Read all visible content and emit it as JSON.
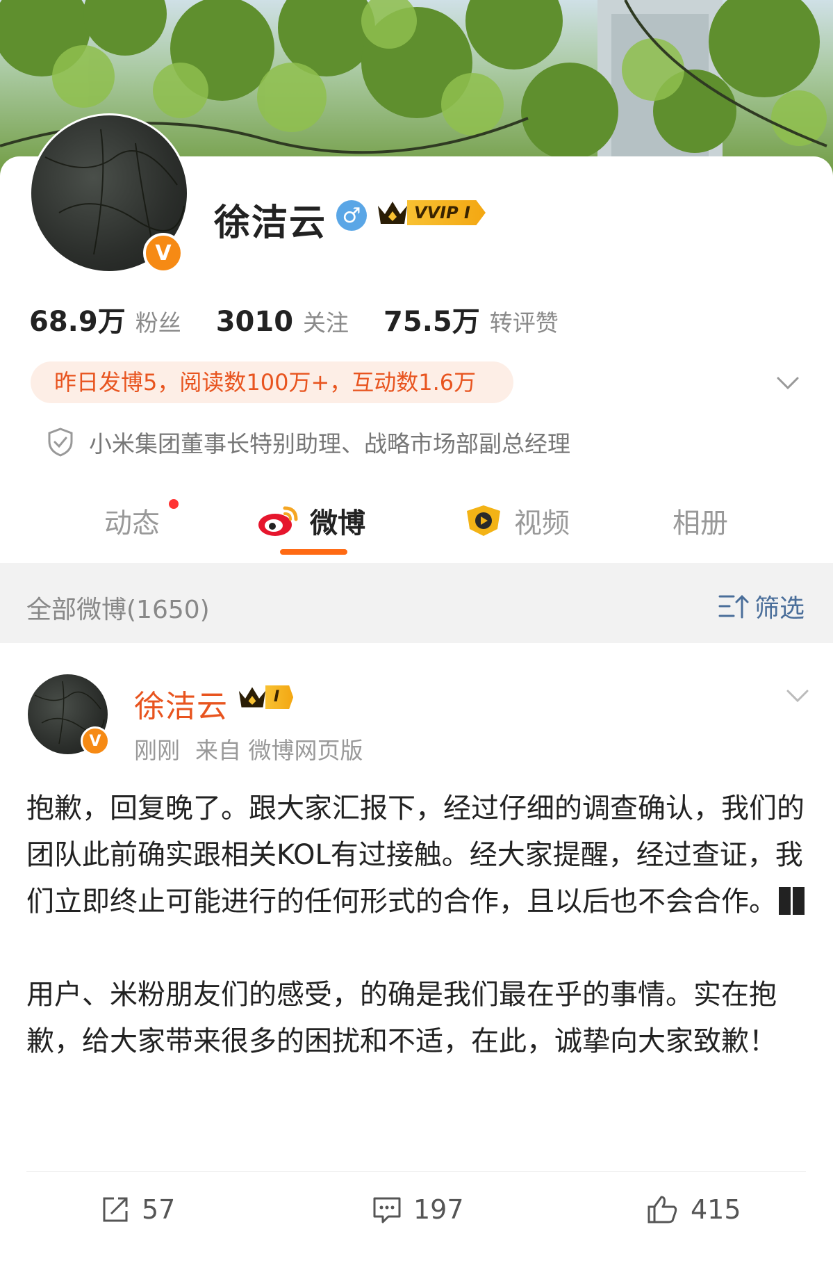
{
  "profile": {
    "name": "徐洁云",
    "gender_icon": "male-icon",
    "vvip_label": "VVIP I",
    "verified_badge": "V",
    "stats": [
      {
        "value": "68.9万",
        "label": "粉丝"
      },
      {
        "value": "3010",
        "label": "关注"
      },
      {
        "value": "75.5万",
        "label": "转评赞"
      }
    ],
    "activity_summary": "昨日发博5，阅读数100万+，互动数1.6万",
    "certification": "小米集团董事长特别助理、战略市场部副总经理"
  },
  "tabs": [
    {
      "label": "动态",
      "has_dot": true
    },
    {
      "label": "微博",
      "active": true
    },
    {
      "label": "视频"
    },
    {
      "label": "相册"
    }
  ],
  "feed": {
    "title": "全部微博(1650)",
    "filter_label": "筛选"
  },
  "post": {
    "author": "徐洁云",
    "rank_label": "I",
    "time": "刚刚",
    "source": "来自 微博网页版",
    "paragraph1": "抱歉，回复晚了。跟大家汇报下，经过仔细的调查确认，我们的团队此前确实跟相关KOL有过接触。经大家提醒，经过查证，我们立即终止可能进行的任何形式的合作，且以后也不会合作。",
    "paragraph2": "用户、米粉朋友们的感受，的确是我们最在乎的事情。实在抱歉，给大家带来很多的困扰和不适，在此，诚挚向大家致歉！",
    "reposts": "57",
    "comments": "197",
    "likes": "415"
  },
  "colors": {
    "accent": "#ff6a13",
    "author_name": "#e8541f",
    "summary_bg": "#fdeee6",
    "filter_blue": "#4a6e9a"
  }
}
